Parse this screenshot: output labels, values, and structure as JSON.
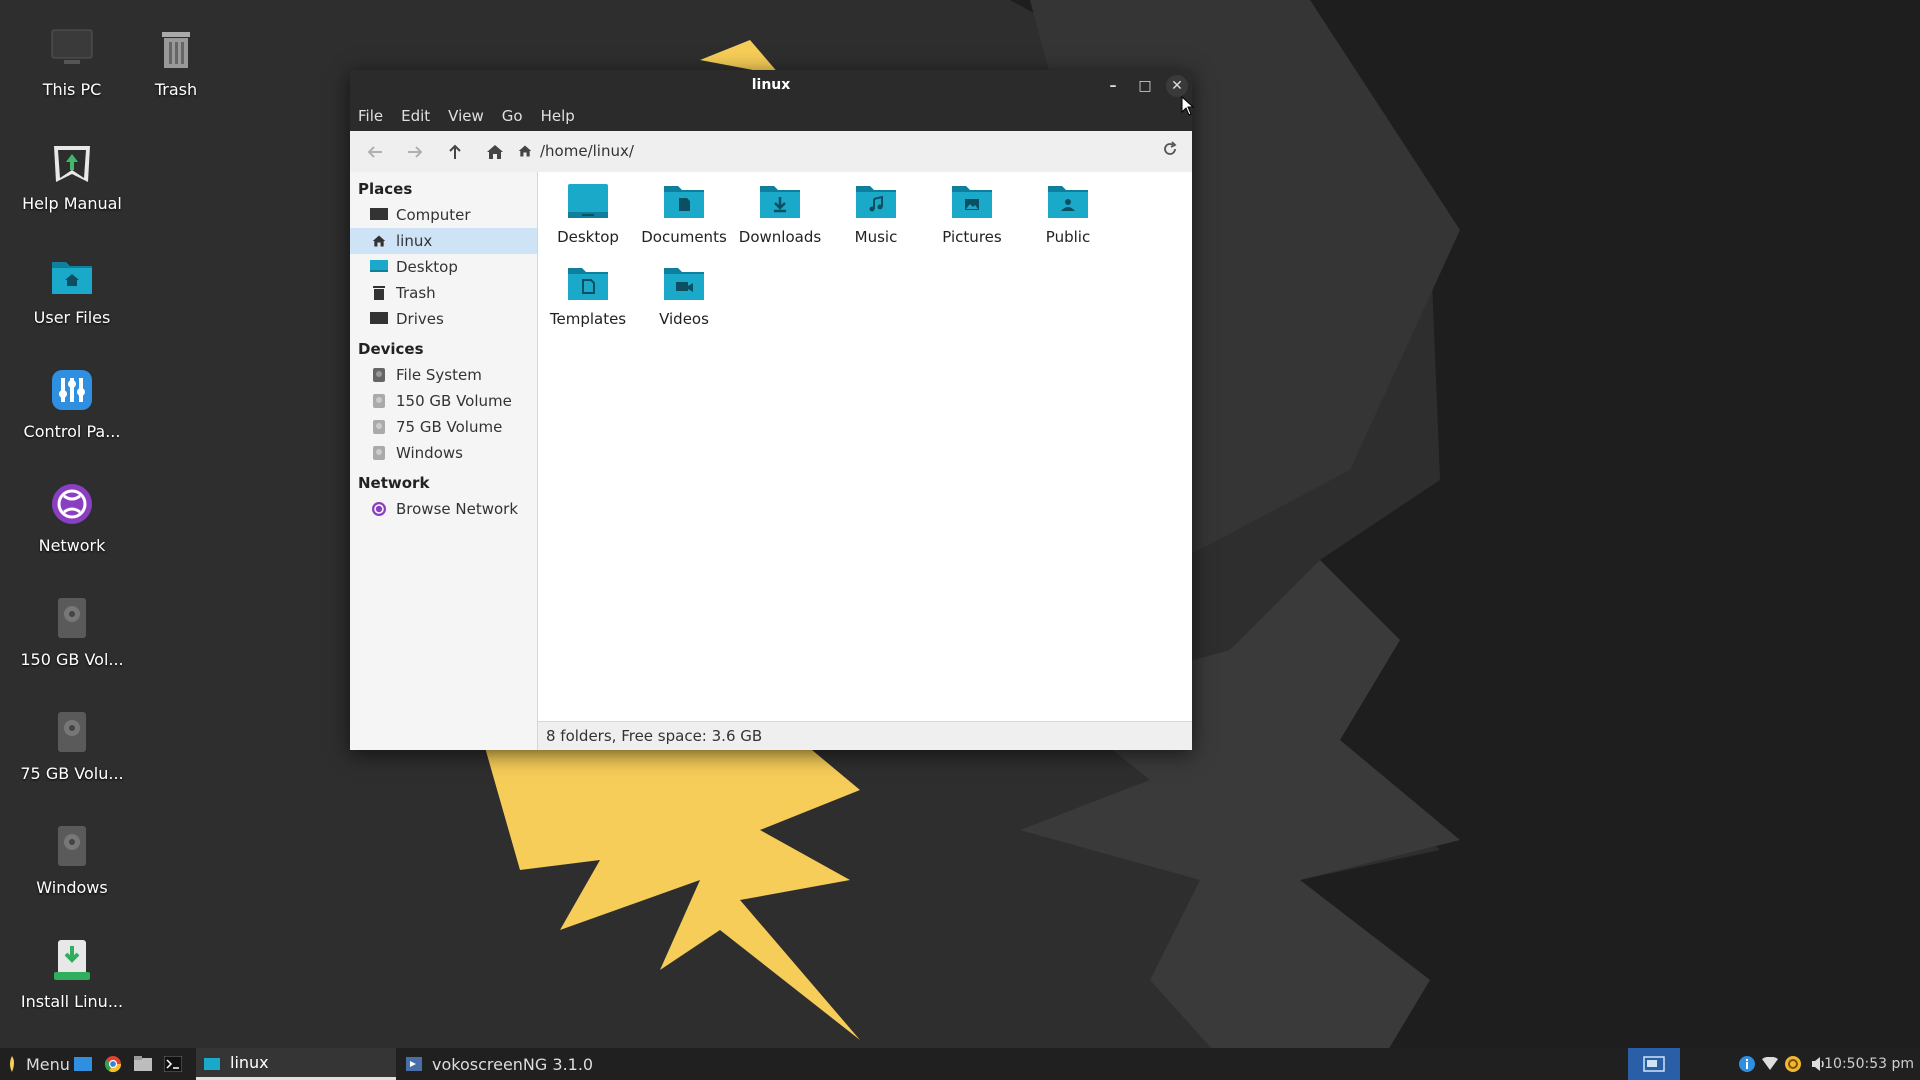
{
  "desktop": {
    "icons": [
      {
        "label": "This PC",
        "icon": "monitor-icon"
      },
      {
        "label": "Trash",
        "icon": "trash-icon"
      },
      {
        "label": "Help Manual",
        "icon": "help-manual-icon"
      },
      {
        "label": "User Files",
        "icon": "home-folder-icon"
      },
      {
        "label": "Control Pa...",
        "icon": "control-panel-icon"
      },
      {
        "label": "Network",
        "icon": "network-globe-icon"
      },
      {
        "label": "150 GB Vol...",
        "icon": "drive-icon"
      },
      {
        "label": "75 GB Volu...",
        "icon": "drive-icon"
      },
      {
        "label": "Windows",
        "icon": "drive-icon"
      },
      {
        "label": "Install Linu...",
        "icon": "install-icon"
      }
    ]
  },
  "window": {
    "title": "linux",
    "controls": {
      "minimize": "–",
      "maximize": "□",
      "close": "✕"
    },
    "menu": [
      "File",
      "Edit",
      "View",
      "Go",
      "Help"
    ],
    "path": "/home/linux/",
    "sidebar": {
      "places_heading": "Places",
      "places": [
        "Computer",
        "linux",
        "Desktop",
        "Trash",
        "Drives"
      ],
      "devices_heading": "Devices",
      "devices": [
        "File System",
        "150 GB Volume",
        "75 GB Volume",
        "Windows"
      ],
      "network_heading": "Network",
      "network": [
        "Browse Network"
      ]
    },
    "files": [
      {
        "name": "Desktop",
        "icon": "desktop-folder-icon"
      },
      {
        "name": "Documents",
        "icon": "documents-folder-icon"
      },
      {
        "name": "Downloads",
        "icon": "downloads-folder-icon"
      },
      {
        "name": "Music",
        "icon": "music-folder-icon"
      },
      {
        "name": "Pictures",
        "icon": "pictures-folder-icon"
      },
      {
        "name": "Public",
        "icon": "public-folder-icon"
      },
      {
        "name": "Templates",
        "icon": "templates-folder-icon"
      },
      {
        "name": "Videos",
        "icon": "videos-folder-icon"
      }
    ],
    "status": "8 folders, Free space: 3.6 GB"
  },
  "taskbar": {
    "menu_label": "Menu",
    "tasks": [
      {
        "label": "linux",
        "active": true
      },
      {
        "label": "vokoscreenNG 3.1.0",
        "active": false
      }
    ],
    "clock": "10:50:53 pm"
  },
  "colors": {
    "folder": "#1ba9c9",
    "folder_dark": "#0e7f9c",
    "accent_selection": "#cfe3f7",
    "wallpaper_yellow": "#f6cd58",
    "wallpaper_dark": "#2b2b2b"
  }
}
